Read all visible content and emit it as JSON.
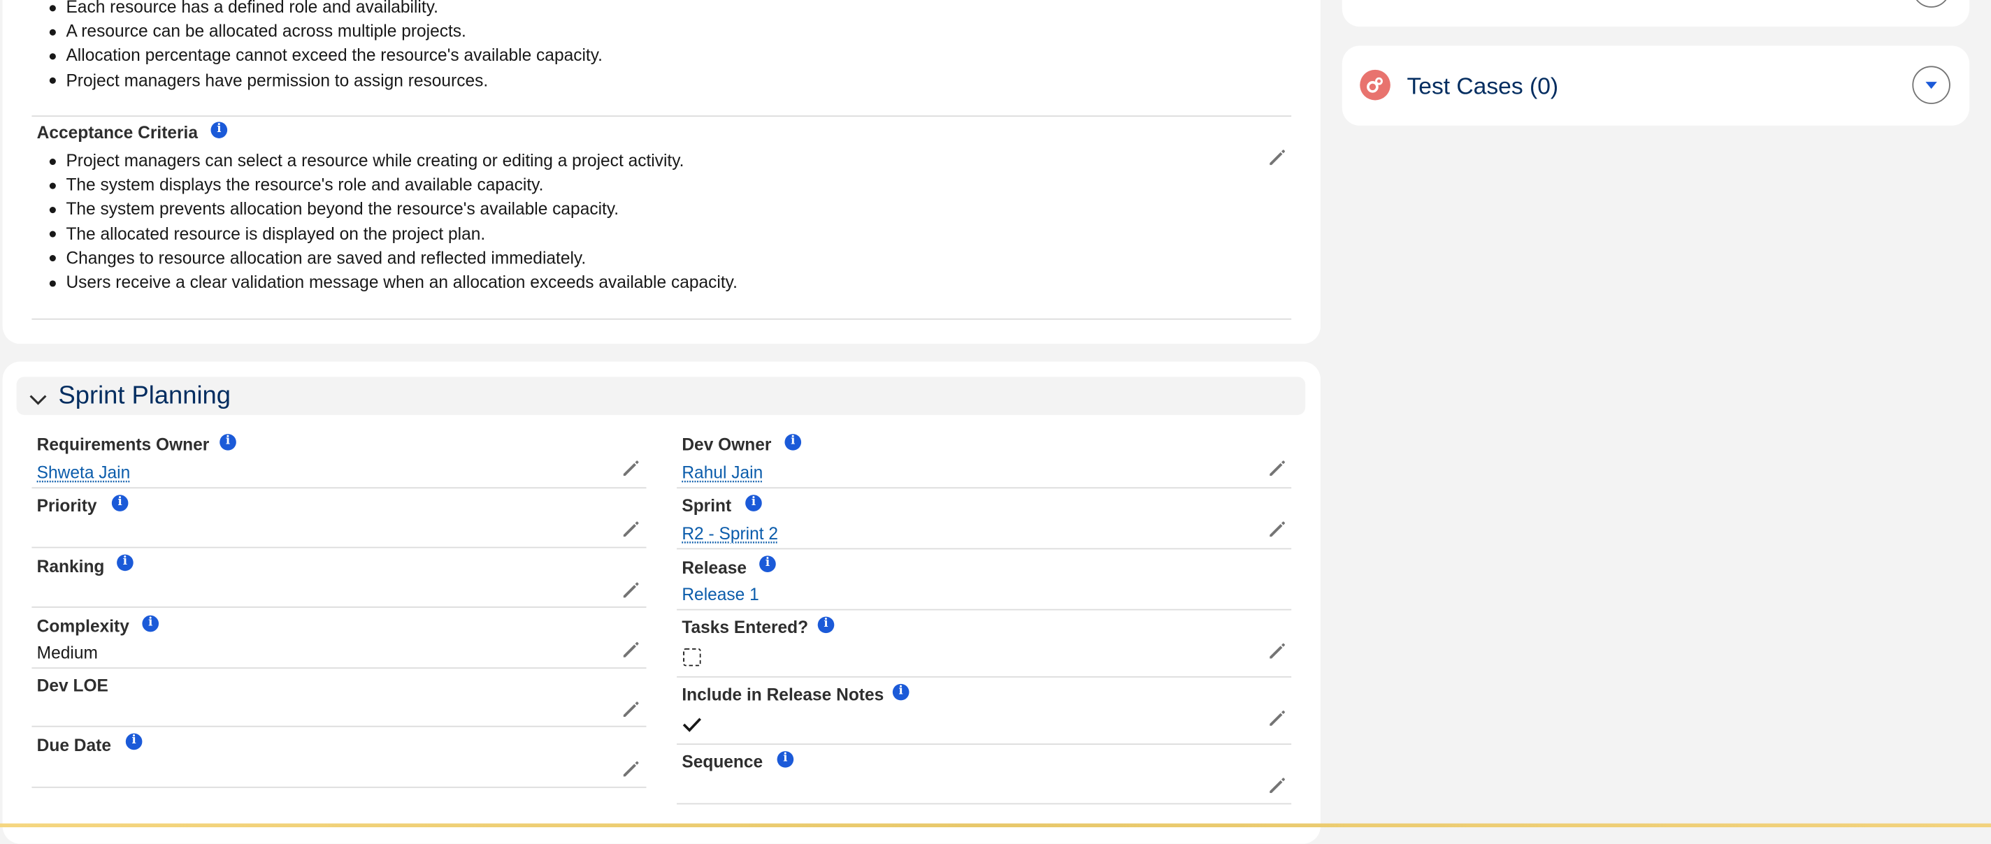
{
  "description": {
    "bullets": [
      "Each resource has a defined role and availability.",
      "A resource can be allocated across multiple projects.",
      "Allocation percentage cannot exceed the resource's available capacity.",
      "Project managers have permission to assign resources."
    ]
  },
  "acceptance": {
    "label": "Acceptance Criteria",
    "bullets": [
      "Project managers can select a resource while creating or editing a project activity.",
      "The system displays the resource's role and available capacity.",
      "The system prevents allocation beyond the resource's available capacity.",
      "The allocated resource is displayed on the project plan.",
      "Changes to resource allocation are saved and reflected immediately.",
      "Users receive a clear validation message when an allocation exceeds available capacity."
    ]
  },
  "related": {
    "test_cases_title": "Test Cases (0)"
  },
  "sprint": {
    "title": "Sprint Planning",
    "left": [
      {
        "label": "Requirements Owner",
        "value": "Shweta Jain"
      },
      {
        "label": "Priority",
        "value": ""
      },
      {
        "label": "Ranking",
        "value": ""
      },
      {
        "label": "Complexity",
        "value": "Medium"
      },
      {
        "label": "Dev LOE",
        "value": ""
      },
      {
        "label": "Due Date",
        "value": ""
      }
    ],
    "right": [
      {
        "label": "Dev Owner",
        "value": "Rahul Jain"
      },
      {
        "label": "Sprint",
        "value": "R2 - Sprint 2"
      },
      {
        "label": "Release",
        "value": "Release 1"
      },
      {
        "label": "Tasks Entered?",
        "checked": false
      },
      {
        "label": "Include in Release Notes",
        "checked": true
      },
      {
        "label": "Sequence",
        "value": ""
      }
    ]
  },
  "icons": {
    "info": "i",
    "edit": "pencil-icon",
    "collapse": "chevron-down-icon",
    "dropdown": "triangle-down-icon"
  },
  "colors": {
    "accent": "#1b5ad8",
    "link": "#0b5cab",
    "title": "#032d60",
    "test_icon": "#e8736e"
  }
}
